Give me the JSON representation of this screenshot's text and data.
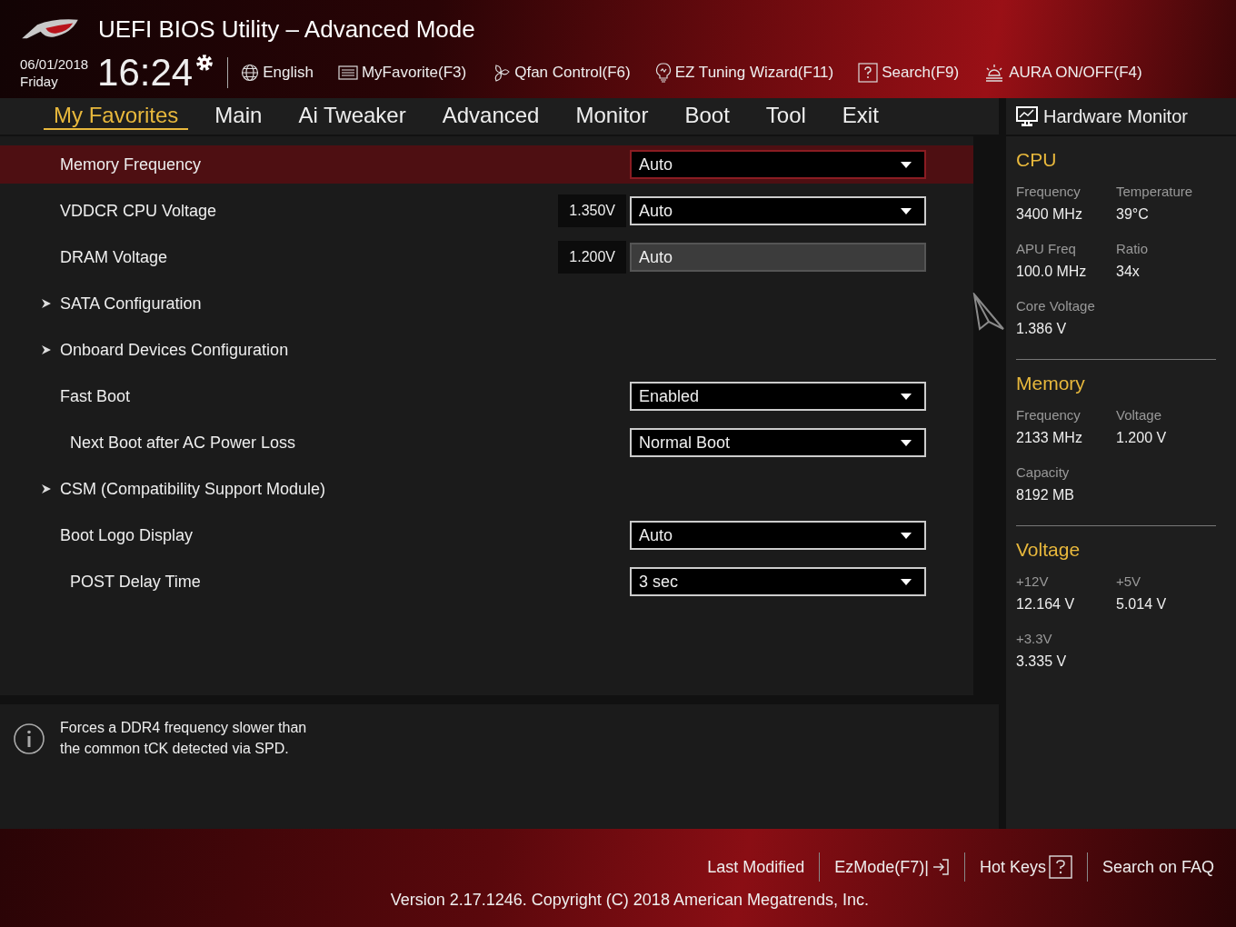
{
  "header": {
    "title": "UEFI BIOS Utility – Advanced Mode",
    "date": "06/01/2018",
    "day": "Friday",
    "time": "16:24",
    "tools": [
      {
        "label": "English"
      },
      {
        "label": "MyFavorite(F3)"
      },
      {
        "label": "Qfan Control(F6)"
      },
      {
        "label": "EZ Tuning Wizard(F11)"
      },
      {
        "label": "Search(F9)"
      },
      {
        "label": "AURA ON/OFF(F4)"
      }
    ]
  },
  "tabs": [
    {
      "label": "My Favorites",
      "selected": true
    },
    {
      "label": "Main",
      "selected": false
    },
    {
      "label": "Ai Tweaker",
      "selected": false
    },
    {
      "label": "Advanced",
      "selected": false
    },
    {
      "label": "Monitor",
      "selected": false
    },
    {
      "label": "Boot",
      "selected": false
    },
    {
      "label": "Tool",
      "selected": false
    },
    {
      "label": "Exit",
      "selected": false
    }
  ],
  "settings": [
    {
      "kind": "dropdown",
      "label": "Memory Frequency",
      "value": "Auto",
      "selected": true,
      "disabled": false
    },
    {
      "kind": "dropdown",
      "label": "VDDCR CPU Voltage",
      "reading": "1.350V",
      "value": "Auto",
      "selected": false,
      "disabled": false
    },
    {
      "kind": "dropdown",
      "label": "DRAM Voltage",
      "reading": "1.200V",
      "value": "Auto",
      "selected": false,
      "disabled": true
    },
    {
      "kind": "submenu",
      "label": "SATA Configuration",
      "selected": false
    },
    {
      "kind": "submenu",
      "label": "Onboard Devices Configuration",
      "selected": false
    },
    {
      "kind": "dropdown",
      "label": "Fast Boot",
      "value": "Enabled",
      "selected": false,
      "disabled": false,
      "children": [
        {
          "kind": "dropdown",
          "label": "Next Boot after AC Power Loss",
          "value": "Normal Boot",
          "selected": false,
          "disabled": false
        }
      ]
    },
    {
      "kind": "submenu",
      "label": "CSM (Compatibility Support Module)",
      "selected": false
    },
    {
      "kind": "dropdown",
      "label": "Boot Logo Display",
      "value": "Auto",
      "selected": false,
      "disabled": false,
      "children": [
        {
          "kind": "dropdown",
          "label": "POST Delay Time",
          "value": "3 sec",
          "selected": false,
          "disabled": false
        }
      ]
    }
  ],
  "help": {
    "lines": [
      "Forces a DDR4 frequency slower than",
      "the common tCK detected via SPD."
    ]
  },
  "monitor": {
    "title": "Hardware Monitor",
    "sections": [
      {
        "title": "CPU",
        "items": [
          {
            "label": "Frequency",
            "value": "3400 MHz"
          },
          {
            "label": "Temperature",
            "value": "39°C"
          },
          {
            "label": "APU Freq",
            "value": "100.0 MHz"
          },
          {
            "label": "Ratio",
            "value": "34x"
          },
          {
            "label": "Core Voltage",
            "value": "1.386 V"
          }
        ]
      },
      {
        "title": "Memory",
        "items": [
          {
            "label": "Frequency",
            "value": "2133 MHz"
          },
          {
            "label": "Voltage",
            "value": "1.200 V"
          },
          {
            "label": "Capacity",
            "value": "8192 MB"
          }
        ]
      },
      {
        "title": "Voltage",
        "items": [
          {
            "label": "+12V",
            "value": "12.164 V"
          },
          {
            "label": "+5V",
            "value": "5.014 V"
          },
          {
            "label": "+3.3V",
            "value": "3.335 V"
          }
        ]
      }
    ]
  },
  "footer": {
    "links": [
      {
        "label": "Last Modified"
      },
      {
        "label": "EzMode(F7)|"
      },
      {
        "label": "Hot Keys"
      },
      {
        "label": "Search on FAQ"
      }
    ],
    "version": "Version 2.17.1246. Copyright (C) 2018 American Megatrends, Inc."
  }
}
